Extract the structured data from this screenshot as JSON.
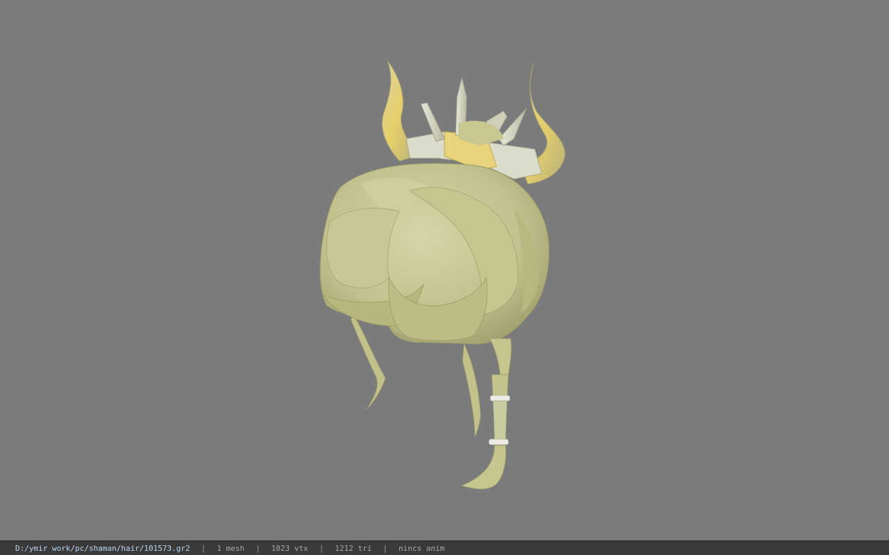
{
  "viewport": {
    "background_color": "#7b7b7b",
    "model": {
      "description_icon": "hair-mesh-3d-model",
      "hair_color": "#c9c896",
      "hair_shadow_color": "#9c9c6c",
      "ornament_color": "#e4d27a",
      "ring_color": "#e8e8e0"
    }
  },
  "statusbar": {
    "file_path": "D:/ymir work/pc/shaman/hair/101573.gr2",
    "separator": "|",
    "mesh_count": "1 mesh",
    "vertex_count": "1023 vtx",
    "triangle_count": "1212 tri",
    "animation": "nincs anim"
  }
}
